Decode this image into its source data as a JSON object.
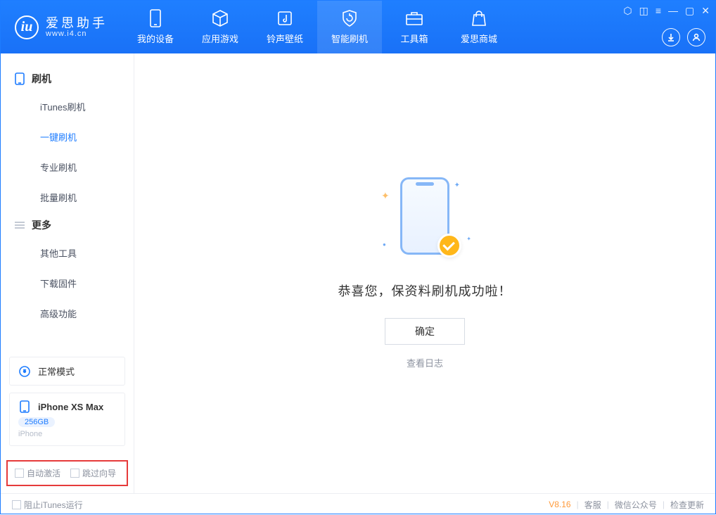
{
  "app": {
    "name_cn": "爱思助手",
    "name_en": "www.i4.cn",
    "logo_letter": "iu"
  },
  "nav": {
    "items": [
      {
        "label": "我的设备"
      },
      {
        "label": "应用游戏"
      },
      {
        "label": "铃声壁纸"
      },
      {
        "label": "智能刷机"
      },
      {
        "label": "工具箱"
      },
      {
        "label": "爱思商城"
      }
    ]
  },
  "sidebar": {
    "group1": {
      "title": "刷机",
      "items": [
        "iTunes刷机",
        "一键刷机",
        "专业刷机",
        "批量刷机"
      ]
    },
    "group2": {
      "title": "更多",
      "items": [
        "其他工具",
        "下载固件",
        "高级功能"
      ]
    },
    "mode_card": {
      "label": "正常模式"
    },
    "device_card": {
      "name": "iPhone XS Max",
      "capacity": "256GB",
      "type": "iPhone"
    },
    "options": {
      "auto_activate": "自动激活",
      "skip_guide": "跳过向导"
    }
  },
  "main": {
    "success_msg": "恭喜您，保资料刷机成功啦！",
    "ok_label": "确定",
    "view_log": "查看日志"
  },
  "footer": {
    "block_itunes": "阻止iTunes运行",
    "version": "V8.16",
    "links": [
      "客服",
      "微信公众号",
      "检查更新"
    ]
  }
}
